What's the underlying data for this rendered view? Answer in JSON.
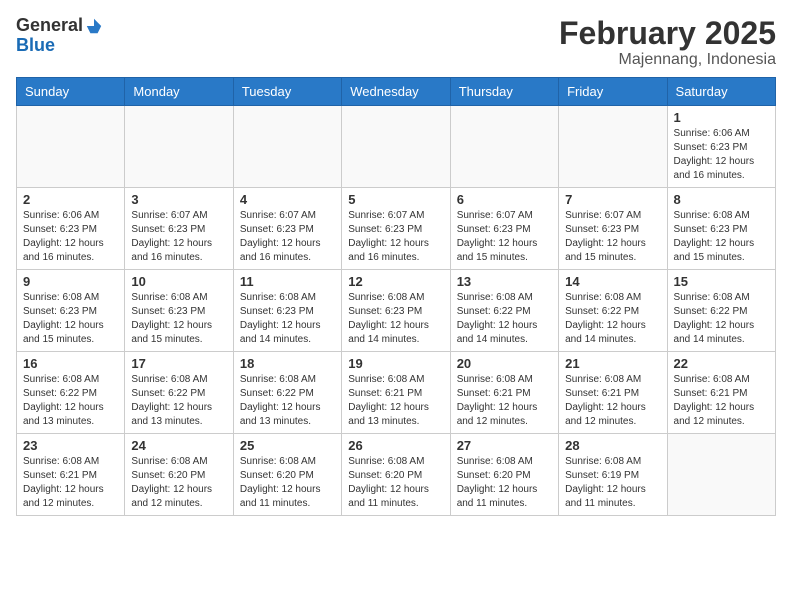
{
  "header": {
    "logo_general": "General",
    "logo_blue": "Blue",
    "month": "February 2025",
    "location": "Majennang, Indonesia"
  },
  "weekdays": [
    "Sunday",
    "Monday",
    "Tuesday",
    "Wednesday",
    "Thursday",
    "Friday",
    "Saturday"
  ],
  "weeks": [
    [
      {
        "day": "",
        "info": ""
      },
      {
        "day": "",
        "info": ""
      },
      {
        "day": "",
        "info": ""
      },
      {
        "day": "",
        "info": ""
      },
      {
        "day": "",
        "info": ""
      },
      {
        "day": "",
        "info": ""
      },
      {
        "day": "1",
        "info": "Sunrise: 6:06 AM\nSunset: 6:23 PM\nDaylight: 12 hours\nand 16 minutes."
      }
    ],
    [
      {
        "day": "2",
        "info": "Sunrise: 6:06 AM\nSunset: 6:23 PM\nDaylight: 12 hours\nand 16 minutes."
      },
      {
        "day": "3",
        "info": "Sunrise: 6:07 AM\nSunset: 6:23 PM\nDaylight: 12 hours\nand 16 minutes."
      },
      {
        "day": "4",
        "info": "Sunrise: 6:07 AM\nSunset: 6:23 PM\nDaylight: 12 hours\nand 16 minutes."
      },
      {
        "day": "5",
        "info": "Sunrise: 6:07 AM\nSunset: 6:23 PM\nDaylight: 12 hours\nand 16 minutes."
      },
      {
        "day": "6",
        "info": "Sunrise: 6:07 AM\nSunset: 6:23 PM\nDaylight: 12 hours\nand 15 minutes."
      },
      {
        "day": "7",
        "info": "Sunrise: 6:07 AM\nSunset: 6:23 PM\nDaylight: 12 hours\nand 15 minutes."
      },
      {
        "day": "8",
        "info": "Sunrise: 6:08 AM\nSunset: 6:23 PM\nDaylight: 12 hours\nand 15 minutes."
      }
    ],
    [
      {
        "day": "9",
        "info": "Sunrise: 6:08 AM\nSunset: 6:23 PM\nDaylight: 12 hours\nand 15 minutes."
      },
      {
        "day": "10",
        "info": "Sunrise: 6:08 AM\nSunset: 6:23 PM\nDaylight: 12 hours\nand 15 minutes."
      },
      {
        "day": "11",
        "info": "Sunrise: 6:08 AM\nSunset: 6:23 PM\nDaylight: 12 hours\nand 14 minutes."
      },
      {
        "day": "12",
        "info": "Sunrise: 6:08 AM\nSunset: 6:23 PM\nDaylight: 12 hours\nand 14 minutes."
      },
      {
        "day": "13",
        "info": "Sunrise: 6:08 AM\nSunset: 6:22 PM\nDaylight: 12 hours\nand 14 minutes."
      },
      {
        "day": "14",
        "info": "Sunrise: 6:08 AM\nSunset: 6:22 PM\nDaylight: 12 hours\nand 14 minutes."
      },
      {
        "day": "15",
        "info": "Sunrise: 6:08 AM\nSunset: 6:22 PM\nDaylight: 12 hours\nand 14 minutes."
      }
    ],
    [
      {
        "day": "16",
        "info": "Sunrise: 6:08 AM\nSunset: 6:22 PM\nDaylight: 12 hours\nand 13 minutes."
      },
      {
        "day": "17",
        "info": "Sunrise: 6:08 AM\nSunset: 6:22 PM\nDaylight: 12 hours\nand 13 minutes."
      },
      {
        "day": "18",
        "info": "Sunrise: 6:08 AM\nSunset: 6:22 PM\nDaylight: 12 hours\nand 13 minutes."
      },
      {
        "day": "19",
        "info": "Sunrise: 6:08 AM\nSunset: 6:21 PM\nDaylight: 12 hours\nand 13 minutes."
      },
      {
        "day": "20",
        "info": "Sunrise: 6:08 AM\nSunset: 6:21 PM\nDaylight: 12 hours\nand 12 minutes."
      },
      {
        "day": "21",
        "info": "Sunrise: 6:08 AM\nSunset: 6:21 PM\nDaylight: 12 hours\nand 12 minutes."
      },
      {
        "day": "22",
        "info": "Sunrise: 6:08 AM\nSunset: 6:21 PM\nDaylight: 12 hours\nand 12 minutes."
      }
    ],
    [
      {
        "day": "23",
        "info": "Sunrise: 6:08 AM\nSunset: 6:21 PM\nDaylight: 12 hours\nand 12 minutes."
      },
      {
        "day": "24",
        "info": "Sunrise: 6:08 AM\nSunset: 6:20 PM\nDaylight: 12 hours\nand 12 minutes."
      },
      {
        "day": "25",
        "info": "Sunrise: 6:08 AM\nSunset: 6:20 PM\nDaylight: 12 hours\nand 11 minutes."
      },
      {
        "day": "26",
        "info": "Sunrise: 6:08 AM\nSunset: 6:20 PM\nDaylight: 12 hours\nand 11 minutes."
      },
      {
        "day": "27",
        "info": "Sunrise: 6:08 AM\nSunset: 6:20 PM\nDaylight: 12 hours\nand 11 minutes."
      },
      {
        "day": "28",
        "info": "Sunrise: 6:08 AM\nSunset: 6:19 PM\nDaylight: 12 hours\nand 11 minutes."
      },
      {
        "day": "",
        "info": ""
      }
    ]
  ]
}
